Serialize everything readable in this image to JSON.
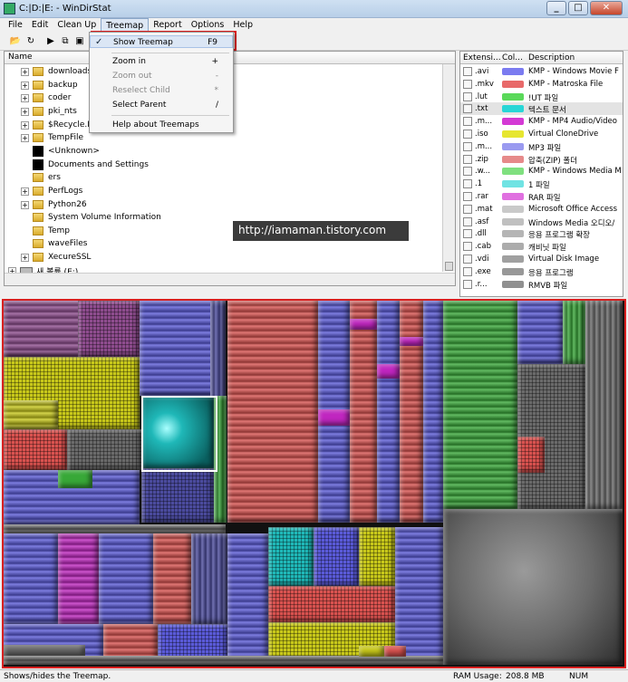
{
  "window": {
    "title": "C:|D:|E: - WinDirStat"
  },
  "menu": [
    "File",
    "Edit",
    "Clean Up",
    "Treemap",
    "Report",
    "Options",
    "Help"
  ],
  "tree": {
    "header": "Name",
    "rows": [
      {
        "label": "downloads",
        "kind": "folder"
      },
      {
        "label": "backup",
        "kind": "folder"
      },
      {
        "label": "coder",
        "kind": "folder"
      },
      {
        "label": "pki_nts",
        "kind": "folder"
      },
      {
        "label": "$Recycle.Bin",
        "kind": "folder"
      },
      {
        "label": "TempFile",
        "kind": "folder"
      },
      {
        "label": "<Unknown>",
        "kind": "black"
      },
      {
        "label": "Documents and Settings",
        "kind": "black"
      },
      {
        "label": "ers",
        "kind": "folder"
      },
      {
        "label": "PerfLogs",
        "kind": "folder"
      },
      {
        "label": "Python26",
        "kind": "folder"
      },
      {
        "label": "System Volume Information",
        "kind": "folder"
      },
      {
        "label": "Temp",
        "kind": "folder"
      },
      {
        "label": "waveFiles",
        "kind": "folder"
      },
      {
        "label": "XecureSSL",
        "kind": "folder"
      },
      {
        "label": "새 볼륨 (E:)",
        "kind": "drive"
      }
    ]
  },
  "extensions": {
    "headers": [
      "Extensi...",
      "Col...",
      "Description"
    ],
    "rows": [
      {
        "ext": ".avi",
        "color": "#7b7bf0",
        "desc": "KMP - Windows Movie F"
      },
      {
        "ext": ".mkv",
        "color": "#e86a6a",
        "desc": "KMP - Matroska File"
      },
      {
        "ext": ".lut",
        "color": "#5ad95a",
        "desc": "!UT 파일"
      },
      {
        "ext": ".txt",
        "color": "#28d6d6",
        "desc": "텍스트 문서"
      },
      {
        "ext": ".m...",
        "color": "#d43ad4",
        "desc": "KMP - MP4 Audio/Video"
      },
      {
        "ext": ".iso",
        "color": "#e6e630",
        "desc": "Virtual CloneDrive"
      },
      {
        "ext": ".m...",
        "color": "#9a9af0",
        "desc": "MP3 파일"
      },
      {
        "ext": ".zip",
        "color": "#e68a8a",
        "desc": "압축(ZIP) 폴더"
      },
      {
        "ext": ".w...",
        "color": "#7fe07f",
        "desc": "KMP - Windows Media M"
      },
      {
        "ext": ".1",
        "color": "#70e3e3",
        "desc": "1 파일"
      },
      {
        "ext": ".rar",
        "color": "#e070e0",
        "desc": "RAR 파일"
      },
      {
        "ext": ".mat",
        "color": "#c9c9c9",
        "desc": "Microsoft Office Access"
      },
      {
        "ext": ".asf",
        "color": "#c0c0c0",
        "desc": "Windows Media 오디오/"
      },
      {
        "ext": ".dll",
        "color": "#b5b5b5",
        "desc": "응용 프로그램 확장"
      },
      {
        "ext": ".cab",
        "color": "#acacac",
        "desc": "캐비닛 파일"
      },
      {
        "ext": ".vdi",
        "color": "#a0a0a0",
        "desc": "Virtual Disk Image"
      },
      {
        "ext": ".exe",
        "color": "#989898",
        "desc": "응용 프로그램"
      },
      {
        "ext": ".r...",
        "color": "#909090",
        "desc": "RMVB 파일"
      }
    ]
  },
  "treemap_menu": {
    "show": {
      "label": "Show Treemap",
      "key": "F9"
    },
    "zoom_in": {
      "label": "Zoom in",
      "key": "+"
    },
    "zoom_out": {
      "label": "Zoom out",
      "key": "-"
    },
    "reselect": {
      "label": "Reselect Child",
      "key": "*"
    },
    "select_parent": {
      "label": "Select Parent",
      "key": "/"
    },
    "help": {
      "label": "Help about Treemaps"
    }
  },
  "watermark": "http://iamaman.tistory.com",
  "status": {
    "hint": "Shows/hides the Treemap.",
    "ram_label": "RAM Usage:",
    "ram_value": "208.8 MB",
    "num": "NUM"
  }
}
